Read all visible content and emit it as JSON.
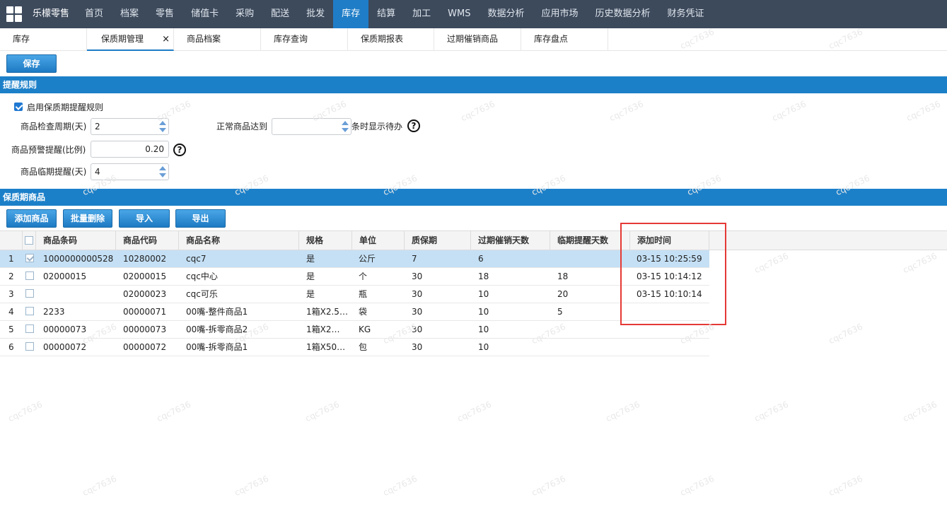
{
  "app": {
    "brand": "乐檬零售",
    "nav": [
      "首页",
      "档案",
      "零售",
      "储值卡",
      "采购",
      "配送",
      "批发",
      "库存",
      "结算",
      "加工",
      "WMS",
      "数据分析",
      "应用市场",
      "历史数据分析",
      "财务凭证"
    ],
    "active_nav": "库存"
  },
  "tabs": [
    {
      "label": "库存"
    },
    {
      "label": "保质期管理",
      "close": "×"
    },
    {
      "label": "商品档案"
    },
    {
      "label": "库存查询"
    },
    {
      "label": "保质期报表"
    },
    {
      "label": "过期催销商品"
    },
    {
      "label": "库存盘点"
    }
  ],
  "toolbar": {
    "save": "保存"
  },
  "rules": {
    "section_title": "提醒规则",
    "enable_label": "启用保质期提醒规则",
    "enable_checked": true,
    "check_cycle_label": "商品检查周期(天)",
    "check_cycle_value": "2",
    "normal_reach_label": "正常商品达到",
    "normal_reach_value": "",
    "normal_reach_suffix": "条时显示待办",
    "warn_ratio_label": "商品预警提醒(比例)",
    "warn_ratio_value": "0.20",
    "near_expiry_label": "商品临期提醒(天)",
    "near_expiry_value": "4",
    "help_glyph": "?"
  },
  "products": {
    "section_title": "保质期商品",
    "buttons": {
      "add": "添加商品",
      "batch_delete": "批量删除",
      "import": "导入",
      "export": "导出"
    },
    "columns": [
      "商品条码",
      "商品代码",
      "商品名称",
      "规格",
      "单位",
      "质保期",
      "过期催销天数",
      "临期提醒天数",
      "添加时间"
    ],
    "rows": [
      {
        "num": "1",
        "checked": true,
        "barcode": "1000000000528",
        "code": "10280002",
        "name": "cqc7",
        "spec": "是",
        "unit": "公斤",
        "shelf": "7",
        "overdue": "6",
        "near": "",
        "added": "03-15 10:25:59"
      },
      {
        "num": "2",
        "checked": false,
        "barcode": "02000015",
        "code": "02000015",
        "name": "cqc中心",
        "spec": "是",
        "unit": "个",
        "shelf": "30",
        "overdue": "18",
        "near": "18",
        "added": "03-15 10:14:12"
      },
      {
        "num": "3",
        "checked": false,
        "barcode": "",
        "code": "02000023",
        "name": "cqc可乐",
        "spec": "是",
        "unit": "瓶",
        "shelf": "30",
        "overdue": "10",
        "near": "20",
        "added": "03-15 10:10:14"
      },
      {
        "num": "4",
        "checked": false,
        "barcode": "2233",
        "code": "00000071",
        "name": "00嘴-整件商品1",
        "spec": "1箱X2.5…",
        "unit": "袋",
        "shelf": "30",
        "overdue": "10",
        "near": "5",
        "added": ""
      },
      {
        "num": "5",
        "checked": false,
        "barcode": "00000073",
        "code": "00000073",
        "name": "00嘴-拆零商品2",
        "spec": "1箱X2…",
        "unit": "KG",
        "shelf": "30",
        "overdue": "10",
        "near": "",
        "added": ""
      },
      {
        "num": "6",
        "checked": false,
        "barcode": "00000072",
        "code": "00000072",
        "name": "00嘴-拆零商品1",
        "spec": "1箱X50…",
        "unit": "包",
        "shelf": "30",
        "overdue": "10",
        "near": "",
        "added": ""
      }
    ]
  },
  "watermark": "cqc7636"
}
